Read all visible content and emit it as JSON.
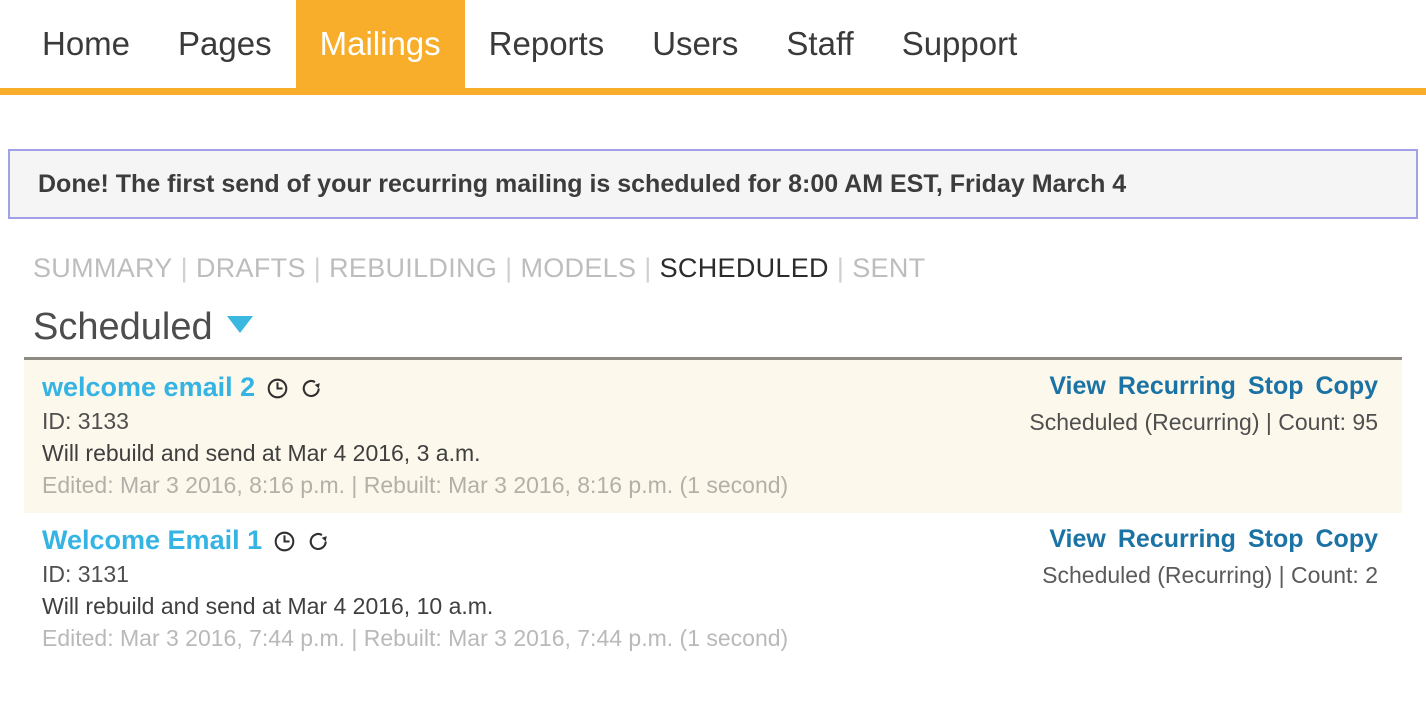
{
  "topnav": {
    "tabs": [
      {
        "label": "Home",
        "active": false
      },
      {
        "label": "Pages",
        "active": false
      },
      {
        "label": "Mailings",
        "active": true
      },
      {
        "label": "Reports",
        "active": false
      },
      {
        "label": "Users",
        "active": false
      },
      {
        "label": "Staff",
        "active": false
      },
      {
        "label": "Support",
        "active": false
      }
    ],
    "accent_color": "#f9ae2b"
  },
  "alert": {
    "message": "Done! The first send of your recurring mailing is scheduled for 8:00 AM EST, Friday March 4",
    "border_color": "#a3a0ea",
    "background_color": "#f5f5f5"
  },
  "filters": {
    "items": [
      {
        "label": "SUMMARY",
        "active": false
      },
      {
        "label": "DRAFTS",
        "active": false
      },
      {
        "label": "REBUILDING",
        "active": false
      },
      {
        "label": "MODELS",
        "active": false
      },
      {
        "label": "SCHEDULED",
        "active": true
      },
      {
        "label": "SENT",
        "active": false
      }
    ],
    "separator": "|"
  },
  "section": {
    "title": "Scheduled",
    "caret_color": "#3ab8e0"
  },
  "mailings": [
    {
      "title": "welcome email 2",
      "id_label": "ID: 3133",
      "schedule": "Will rebuild and send at Mar 4 2016, 3 a.m.",
      "meta": "Edited: Mar 3 2016, 8:16 p.m.  |  Rebuilt: Mar 3 2016, 8:16 p.m. (1 second)",
      "actions": [
        "View",
        "Recurring",
        "Stop",
        "Copy"
      ],
      "status": "Scheduled (Recurring)  |  Count: 95",
      "highlighted": true,
      "icons": [
        "clock-icon",
        "recurring-icon"
      ]
    },
    {
      "title": "Welcome Email 1",
      "id_label": "ID: 3131",
      "schedule": "Will rebuild and send at Mar 4 2016, 10 a.m.",
      "meta": "Edited: Mar 3 2016, 7:44 p.m.  |  Rebuilt: Mar 3 2016, 7:44 p.m. (1 second)",
      "actions": [
        "View",
        "Recurring",
        "Stop",
        "Copy"
      ],
      "status": "Scheduled (Recurring)  |  Count: 2",
      "highlighted": false,
      "icons": [
        "clock-icon",
        "recurring-icon"
      ]
    }
  ]
}
